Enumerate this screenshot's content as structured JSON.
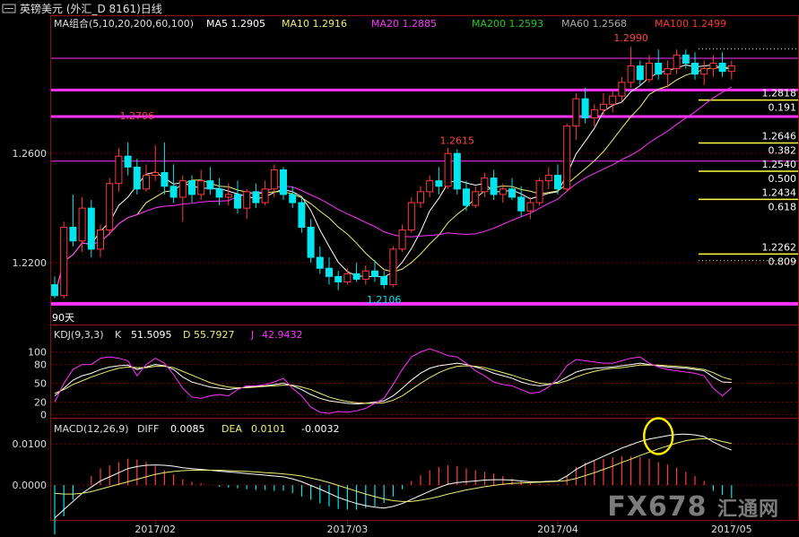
{
  "window": {
    "title": "英镑美元 (外汇_D 8161)日线",
    "icon": "window-menu-icon"
  },
  "colors": {
    "bg": "#000000",
    "grid": "#7a0000",
    "axis": "#8a1111",
    "up": "#ff3b3b",
    "down": "#00e5ee",
    "ma5": "#ffffff",
    "ma10": "#eeee77",
    "ma20": "#ff33ff",
    "ma60": "#aaaaaa",
    "ma100": "#ff3333",
    "ma200": "#22cc22",
    "fib": "#ffff44",
    "hline": "#ff33ff",
    "kdj_k": "#ffffff",
    "kdj_d": "#eeee77",
    "kdj_j": "#ff33ff",
    "highlight": "#ffee00"
  },
  "chart_data": [
    {
      "type": "candlestick",
      "name": "price",
      "ma_legend": [
        {
          "label": "MA组合(5,10,20,200,60,100)",
          "color": "#dddddd"
        },
        {
          "label": "MA5 1.2905",
          "color": "#ffffff"
        },
        {
          "label": "MA10 1.2916",
          "color": "#eeee77"
        },
        {
          "label": "MA20 1.2885",
          "color": "#ff33ff"
        },
        {
          "label": "MA200 1.2593",
          "color": "#22cc22"
        },
        {
          "label": "MA60 1.2568",
          "color": "#aaaaaa"
        },
        {
          "label": "MA100 1.2499",
          "color": "#ff3333"
        }
      ],
      "y_ticks": [
        {
          "value": 1.26,
          "label": "1.2600"
        },
        {
          "value": 1.22,
          "label": "1.2200"
        }
      ],
      "ylim": [
        1.203,
        1.303
      ],
      "x_ticks": [
        {
          "index": 11,
          "label": "2017/02"
        },
        {
          "index": 32,
          "label": "2017/03"
        },
        {
          "index": 55,
          "label": "2017/04"
        },
        {
          "index": 74,
          "label": "2017/05"
        }
      ],
      "candles": [
        [
          1.212,
          1.215,
          1.207,
          1.208
        ],
        [
          1.208,
          1.235,
          1.207,
          1.233
        ],
        [
          1.233,
          1.245,
          1.226,
          1.228
        ],
        [
          1.228,
          1.244,
          1.224,
          1.24
        ],
        [
          1.24,
          1.243,
          1.222,
          1.225
        ],
        [
          1.225,
          1.234,
          1.222,
          1.232
        ],
        [
          1.232,
          1.251,
          1.23,
          1.249
        ],
        [
          1.249,
          1.262,
          1.246,
          1.259
        ],
        [
          1.259,
          1.264,
          1.252,
          1.255
        ],
        [
          1.255,
          1.258,
          1.245,
          1.247
        ],
        [
          1.247,
          1.256,
          1.246,
          1.252
        ],
        [
          1.252,
          1.263,
          1.25,
          1.253
        ],
        [
          1.253,
          1.264,
          1.245,
          1.248
        ],
        [
          1.248,
          1.256,
          1.242,
          1.244
        ],
        [
          1.244,
          1.252,
          1.235,
          1.25
        ],
        [
          1.25,
          1.252,
          1.242,
          1.245
        ],
        [
          1.245,
          1.254,
          1.243,
          1.25
        ],
        [
          1.25,
          1.255,
          1.245,
          1.247
        ],
        [
          1.247,
          1.251,
          1.241,
          1.244
        ],
        [
          1.244,
          1.249,
          1.241,
          1.245
        ],
        [
          1.245,
          1.25,
          1.238,
          1.24
        ],
        [
          1.24,
          1.247,
          1.236,
          1.246
        ],
        [
          1.246,
          1.249,
          1.24,
          1.242
        ],
        [
          1.242,
          1.25,
          1.241,
          1.247
        ],
        [
          1.247,
          1.256,
          1.244,
          1.254
        ],
        [
          1.254,
          1.255,
          1.243,
          1.245
        ],
        [
          1.245,
          1.248,
          1.24,
          1.242
        ],
        [
          1.242,
          1.244,
          1.231,
          1.233
        ],
        [
          1.233,
          1.236,
          1.22,
          1.222
        ],
        [
          1.222,
          1.226,
          1.216,
          1.218
        ],
        [
          1.218,
          1.222,
          1.212,
          1.215
        ],
        [
          1.215,
          1.217,
          1.21,
          1.213
        ],
        [
          1.213,
          1.218,
          1.212,
          1.216
        ],
        [
          1.216,
          1.22,
          1.213,
          1.214
        ],
        [
          1.214,
          1.219,
          1.212,
          1.217
        ],
        [
          1.217,
          1.221,
          1.213,
          1.215
        ],
        [
          1.215,
          1.217,
          1.2106,
          1.212
        ],
        [
          1.212,
          1.226,
          1.211,
          1.225
        ],
        [
          1.225,
          1.234,
          1.224,
          1.232
        ],
        [
          1.232,
          1.244,
          1.231,
          1.242
        ],
        [
          1.242,
          1.248,
          1.24,
          1.246
        ],
        [
          1.246,
          1.252,
          1.244,
          1.25
        ],
        [
          1.25,
          1.255,
          1.245,
          1.248
        ],
        [
          1.248,
          1.262,
          1.247,
          1.26
        ],
        [
          1.26,
          1.2615,
          1.245,
          1.247
        ],
        [
          1.247,
          1.25,
          1.239,
          1.241
        ],
        [
          1.241,
          1.248,
          1.24,
          1.246
        ],
        [
          1.246,
          1.253,
          1.244,
          1.251
        ],
        [
          1.251,
          1.254,
          1.243,
          1.245
        ],
        [
          1.245,
          1.249,
          1.242,
          1.247
        ],
        [
          1.247,
          1.251,
          1.243,
          1.244
        ],
        [
          1.244,
          1.248,
          1.237,
          1.239
        ],
        [
          1.239,
          1.244,
          1.236,
          1.242
        ],
        [
          1.242,
          1.251,
          1.241,
          1.25
        ],
        [
          1.25,
          1.255,
          1.247,
          1.252
        ],
        [
          1.252,
          1.256,
          1.245,
          1.247
        ],
        [
          1.247,
          1.271,
          1.246,
          1.27
        ],
        [
          1.27,
          1.282,
          1.265,
          1.28
        ],
        [
          1.28,
          1.284,
          1.271,
          1.273
        ],
        [
          1.273,
          1.278,
          1.27,
          1.276
        ],
        [
          1.276,
          1.282,
          1.274,
          1.278
        ],
        [
          1.278,
          1.283,
          1.275,
          1.281
        ],
        [
          1.281,
          1.288,
          1.279,
          1.286
        ],
        [
          1.286,
          1.299,
          1.284,
          1.292
        ],
        [
          1.292,
          1.294,
          1.285,
          1.287
        ],
        [
          1.287,
          1.296,
          1.286,
          1.293
        ],
        [
          1.293,
          1.298,
          1.287,
          1.289
        ],
        [
          1.289,
          1.294,
          1.284,
          1.291
        ],
        [
          1.291,
          1.298,
          1.289,
          1.296
        ],
        [
          1.296,
          1.298,
          1.291,
          1.293
        ],
        [
          1.293,
          1.297,
          1.287,
          1.289
        ],
        [
          1.289,
          1.294,
          1.285,
          1.291
        ],
        [
          1.291,
          1.296,
          1.288,
          1.293
        ],
        [
          1.293,
          1.297,
          1.288,
          1.29
        ],
        [
          1.29,
          1.294,
          1.287,
          1.292
        ]
      ],
      "annotations": [
        {
          "text": "1.2706",
          "index": 9,
          "value": 1.2706,
          "color": "#ff4444"
        },
        {
          "text": "1.2615",
          "index": 44,
          "value": 1.2615,
          "color": "#ff4444"
        },
        {
          "text": "1.2106",
          "index": 36,
          "value": 1.2106,
          "color": "#00e5ee"
        },
        {
          "text": "1.2990",
          "index": 63,
          "value": 1.299,
          "color": "#ff4444"
        }
      ],
      "horizontal_lines": [
        {
          "value": 1.2948,
          "color": "#ff33ff",
          "width": 1
        },
        {
          "value": 1.2832,
          "color": "#ff33ff",
          "width": 3
        },
        {
          "value": 1.2735,
          "color": "#ff33ff",
          "width": 3
        },
        {
          "value": 1.2572,
          "color": "#ff33ff",
          "width": 1
        },
        {
          "value": 1.205,
          "color": "#ff33ff",
          "width": 4
        }
      ],
      "fib_levels": [
        {
          "price": "1.2818",
          "ratio": "0.191",
          "value": 1.2795
        },
        {
          "price": "1.2646",
          "ratio": "0.382",
          "value": 1.2638
        },
        {
          "price": "1.2540",
          "ratio": "0.500",
          "value": 1.2535
        },
        {
          "price": "1.2434",
          "ratio": "0.618",
          "value": 1.2432
        },
        {
          "price": "1.2262",
          "ratio": "0.809",
          "value": 1.2232
        }
      ],
      "corner_label": "90天"
    },
    {
      "type": "line",
      "name": "KDJ",
      "legend": [
        {
          "label": "KDJ(9,3,3)",
          "color": "#dddddd"
        },
        {
          "label": "K",
          "color": "#dddddd"
        },
        {
          "label": "51.5095",
          "color": "#ffffff"
        },
        {
          "label": "D",
          "color": "#eeee77"
        },
        {
          "label": "55.7927",
          "color": "#eeee77"
        },
        {
          "label": "J",
          "color": "#ff33ff"
        },
        {
          "label": "42.9432",
          "color": "#ff33ff"
        }
      ],
      "y_ticks": [
        {
          "value": 100,
          "label": "100"
        },
        {
          "value": 80,
          "label": "80"
        },
        {
          "value": 50,
          "label": "50"
        },
        {
          "value": 20,
          "label": "20"
        },
        {
          "value": 0,
          "label": "0"
        }
      ],
      "ylim": [
        -5,
        118
      ],
      "series": [
        {
          "name": "K",
          "values": [
            30,
            42,
            55,
            62,
            66,
            72,
            76,
            78,
            79,
            72,
            76,
            80,
            78,
            72,
            60,
            52,
            48,
            44,
            42,
            40,
            42,
            44,
            45,
            46,
            48,
            50,
            46,
            40,
            32,
            26,
            22,
            20,
            18,
            17,
            18,
            20,
            22,
            30,
            42,
            55,
            66,
            74,
            78,
            80,
            82,
            80,
            76,
            72,
            66,
            62,
            58,
            52,
            48,
            46,
            48,
            52,
            60,
            68,
            72,
            74,
            75,
            76,
            78,
            80,
            82,
            80,
            78,
            76,
            75,
            74,
            72,
            70,
            60,
            52,
            51.5
          ]
        },
        {
          "name": "D",
          "values": [
            34,
            40,
            48,
            54,
            60,
            65,
            70,
            74,
            76,
            75,
            75,
            77,
            77,
            75,
            69,
            63,
            57,
            51,
            47,
            44,
            43,
            43,
            44,
            45,
            46,
            47,
            47,
            44,
            40,
            34,
            28,
            24,
            21,
            19,
            18,
            18,
            19,
            23,
            30,
            40,
            50,
            59,
            67,
            73,
            77,
            78,
            77,
            75,
            71,
            67,
            63,
            58,
            54,
            50,
            49,
            50,
            54,
            60,
            65,
            69,
            72,
            74,
            75,
            77,
            79,
            79,
            79,
            78,
            77,
            76,
            74,
            72,
            67,
            60,
            55.8
          ]
        },
        {
          "name": "J",
          "values": [
            20,
            50,
            72,
            80,
            80,
            90,
            92,
            90,
            86,
            62,
            80,
            90,
            82,
            64,
            42,
            28,
            26,
            30,
            32,
            30,
            40,
            46,
            46,
            48,
            52,
            58,
            42,
            30,
            12,
            4,
            2,
            5,
            4,
            6,
            10,
            18,
            26,
            48,
            72,
            92,
            100,
            105,
            100,
            94,
            92,
            82,
            70,
            62,
            52,
            48,
            46,
            40,
            34,
            36,
            44,
            58,
            78,
            88,
            86,
            84,
            82,
            82,
            86,
            90,
            92,
            82,
            76,
            72,
            70,
            68,
            66,
            62,
            42,
            30,
            42.9
          ]
        }
      ]
    },
    {
      "type": "bar+line",
      "name": "MACD",
      "legend": [
        {
          "label": "MACD(12,26,9)",
          "color": "#dddddd"
        },
        {
          "label": "DIFF",
          "color": "#dddddd"
        },
        {
          "label": "0.0085",
          "color": "#ffffff"
        },
        {
          "label": "DEA",
          "color": "#eeee77"
        },
        {
          "label": "0.0101",
          "color": "#eeee77"
        },
        {
          "label": "-0.0032",
          "color": "#ffffff"
        }
      ],
      "y_ticks": [
        {
          "value": 0.01,
          "label": "0.0100"
        },
        {
          "value": 0,
          "label": "0.0000"
        }
      ],
      "ylim": [
        -0.0085,
        0.0155
      ],
      "diff": [
        -0.008,
        -0.006,
        -0.004,
        -0.002,
        -0.0005,
        0.001,
        0.002,
        0.003,
        0.004,
        0.0045,
        0.0048,
        0.0049,
        0.0048,
        0.0046,
        0.0042,
        0.004,
        0.0038,
        0.0036,
        0.0034,
        0.0032,
        0.003,
        0.0028,
        0.0026,
        0.0024,
        0.0022,
        0.002,
        0.0015,
        0.0008,
        -0.0001,
        -0.001,
        -0.002,
        -0.003,
        -0.0038,
        -0.0045,
        -0.005,
        -0.0054,
        -0.0056,
        -0.0052,
        -0.0045,
        -0.0035,
        -0.0025,
        -0.0015,
        -0.0006,
        0.0002,
        0.0006,
        0.0008,
        0.001,
        0.0012,
        0.0013,
        0.0013,
        0.0012,
        0.001,
        0.0008,
        0.0008,
        0.0009,
        0.001,
        0.0022,
        0.0038,
        0.005,
        0.006,
        0.007,
        0.008,
        0.009,
        0.0098,
        0.0106,
        0.0112,
        0.0116,
        0.012,
        0.0123,
        0.0124,
        0.0122,
        0.0118,
        0.0105,
        0.0094,
        0.0085
      ],
      "dea": [
        -0.002,
        -0.0022,
        -0.0022,
        -0.002,
        -0.0016,
        -0.001,
        -0.0004,
        0.0002,
        0.0008,
        0.0014,
        0.002,
        0.0026,
        0.003,
        0.0033,
        0.0035,
        0.0036,
        0.0036,
        0.0036,
        0.0036,
        0.0035,
        0.0034,
        0.0033,
        0.0032,
        0.003,
        0.0029,
        0.0027,
        0.0025,
        0.0022,
        0.0017,
        0.0012,
        0.0006,
        -0.0001,
        -0.0008,
        -0.0015,
        -0.0022,
        -0.0028,
        -0.0034,
        -0.0038,
        -0.004,
        -0.004,
        -0.0037,
        -0.0033,
        -0.0028,
        -0.0022,
        -0.0017,
        -0.0012,
        -0.0008,
        -0.0004,
        -0.0001,
        0.0002,
        0.0004,
        0.0005,
        0.0006,
        0.0007,
        0.0008,
        0.0009,
        0.0011,
        0.0016,
        0.0023,
        0.003,
        0.0038,
        0.0046,
        0.0055,
        0.0063,
        0.0072,
        0.008,
        0.0088,
        0.0095,
        0.0102,
        0.0108,
        0.0111,
        0.0113,
        0.0112,
        0.0106,
        0.0101
      ],
      "histogram_scale": 1.0,
      "highlight": {
        "index": 66,
        "value": 0.0119,
        "shape": "ellipse"
      }
    }
  ],
  "watermark": {
    "text": "FX678",
    "suffix": "汇通网"
  }
}
